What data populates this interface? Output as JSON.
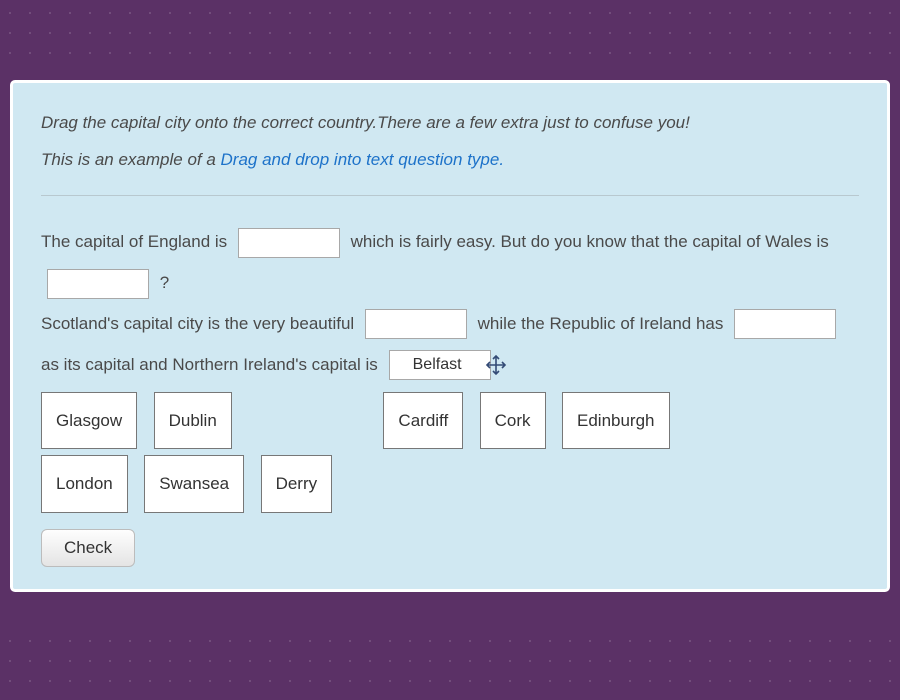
{
  "intro": {
    "line1_before": "Drag the capital city onto the correct country.There are a few extra just to confuse you!",
    "line2_before": "This is an example of a ",
    "link_text": "Drag and drop into text question type."
  },
  "question": {
    "p1_a": "The capital of England is",
    "p1_b": "which is fairly easy. But do you know that the capital of Wales is",
    "p1_c": "?",
    "p2_a": "Scotland's capital city is the very beautiful",
    "p2_b": "while the Republic of Ireland has",
    "p2_c": "as its capital and Northern Ireland's capital is",
    "slot5_value": "Belfast"
  },
  "drag_options_row1": [
    "Glasgow",
    "Dublin",
    "",
    "Cardiff",
    "Cork",
    "Edinburgh"
  ],
  "drag_options_row2": [
    "London",
    "Swansea",
    "Derry"
  ],
  "buttons": {
    "check": "Check"
  }
}
